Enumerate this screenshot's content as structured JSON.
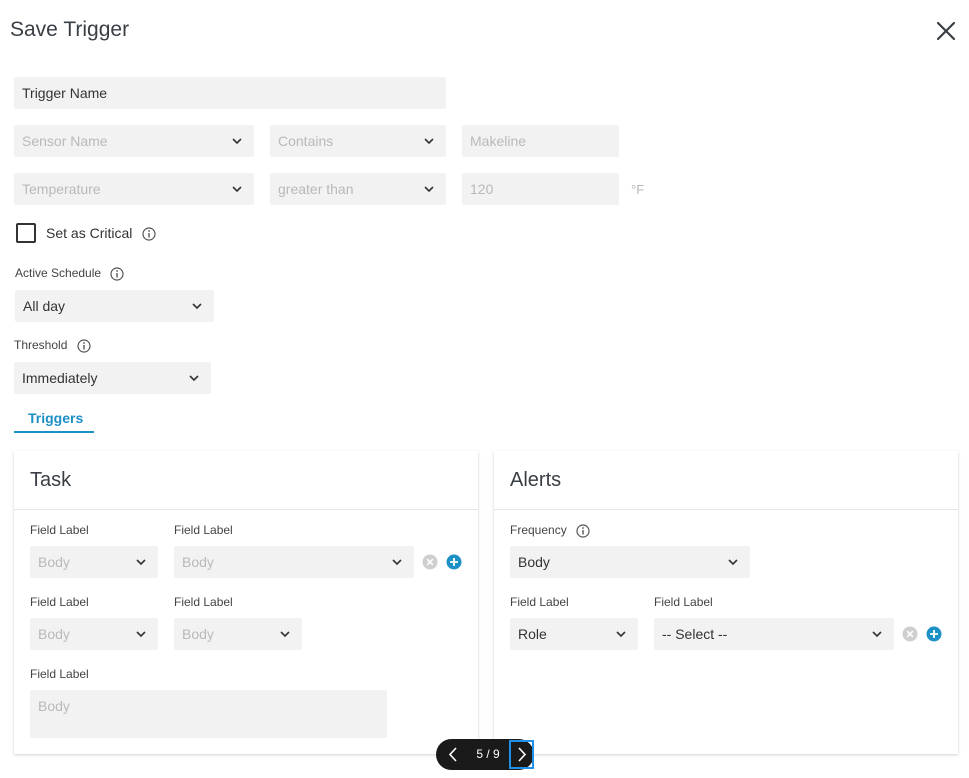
{
  "dialog": {
    "title": "Save Trigger"
  },
  "form": {
    "trigger_name": "Trigger Name",
    "sensor_name": "Sensor Name",
    "sensor_op": "Contains",
    "sensor_value": "Makeline",
    "metric": "Temperature",
    "metric_op": "greater than",
    "metric_value": "120",
    "metric_unit": "°F",
    "critical_label": "Set as Critical",
    "active_schedule_label": "Active Schedule",
    "active_schedule_value": "All day",
    "threshold_label": "Threshold",
    "threshold_value": "Immediately"
  },
  "tabs": [
    {
      "label": "Triggers",
      "active": true
    }
  ],
  "task": {
    "title": "Task",
    "field_label": "Field Label",
    "body": "Body"
  },
  "alerts": {
    "title": "Alerts",
    "frequency_label": "Frequency",
    "frequency_value": "Body",
    "field_label": "Field Label",
    "role_value": "Role",
    "select_placeholder": "-- Select --"
  },
  "pager": {
    "text": "5 / 9"
  },
  "colors": {
    "accent": "#1e90c8",
    "field_bg": "#f2f2f2",
    "pager_bg": "#1a1a1a"
  },
  "icons": [
    "close-icon",
    "chevron-down-icon",
    "info-icon",
    "clear-icon",
    "add-icon",
    "chevron-left-icon",
    "chevron-right-icon"
  ]
}
